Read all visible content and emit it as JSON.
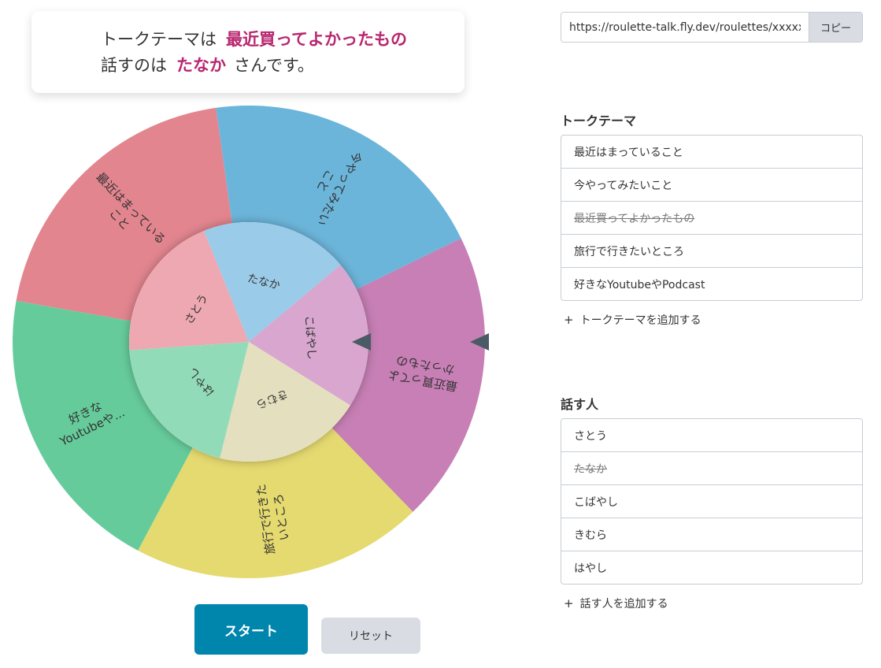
{
  "result": {
    "line1_prefix": "トークテーマは",
    "line1_value": "最近買ってよかったもの",
    "line2_prefix": "話すのは",
    "line2_value": "たなか",
    "line2_suffix": "さんです。"
  },
  "roulette": {
    "outer_segments": [
      {
        "label_lines": [
          "最近はまっている",
          "こと"
        ],
        "color": "#e2858f"
      },
      {
        "label_lines": [
          "今やってみたい",
          "こと"
        ],
        "color": "#6cb5da"
      },
      {
        "label_lines": [
          "最近買ってよ",
          "かったもの"
        ],
        "color": "#c77fb5"
      },
      {
        "label_lines": [
          "旅行で行きた",
          "いところ"
        ],
        "color": "#e5da70"
      },
      {
        "label_lines": [
          "好きな",
          "Youtubeや..."
        ],
        "color": "#66cb9b"
      }
    ],
    "inner_segments": [
      {
        "label": "さとう",
        "color": "#eda8b1"
      },
      {
        "label": "たなか",
        "color": "#9acbe8"
      },
      {
        "label": "こばやし",
        "color": "#d8a6cf"
      },
      {
        "label": "きむら",
        "color": "#e4dfbe"
      },
      {
        "label": "はやし",
        "color": "#92dbb8"
      }
    ],
    "pointer_color": "#4a5b66"
  },
  "buttons": {
    "start": "スタート",
    "reset": "リセット"
  },
  "share": {
    "url": "https://roulette-talk.fly.dev/roulettes/xxxxx",
    "copy_label": "コピー"
  },
  "themes": {
    "title": "トークテーマ",
    "items": [
      {
        "label": "最近はまっていること",
        "done": false
      },
      {
        "label": "今やってみたいこと",
        "done": false
      },
      {
        "label": "最近買ってよかったもの",
        "done": true
      },
      {
        "label": "旅行で行きたいところ",
        "done": false
      },
      {
        "label": "好きなYoutubeやPodcast",
        "done": false
      }
    ],
    "add_label": "トークテーマを追加する"
  },
  "speakers": {
    "title": "話す人",
    "items": [
      {
        "label": "さとう",
        "done": false
      },
      {
        "label": "たなか",
        "done": true
      },
      {
        "label": "こばやし",
        "done": false
      },
      {
        "label": "きむら",
        "done": false
      },
      {
        "label": "はやし",
        "done": false
      }
    ],
    "add_label": "話す人を追加する"
  }
}
